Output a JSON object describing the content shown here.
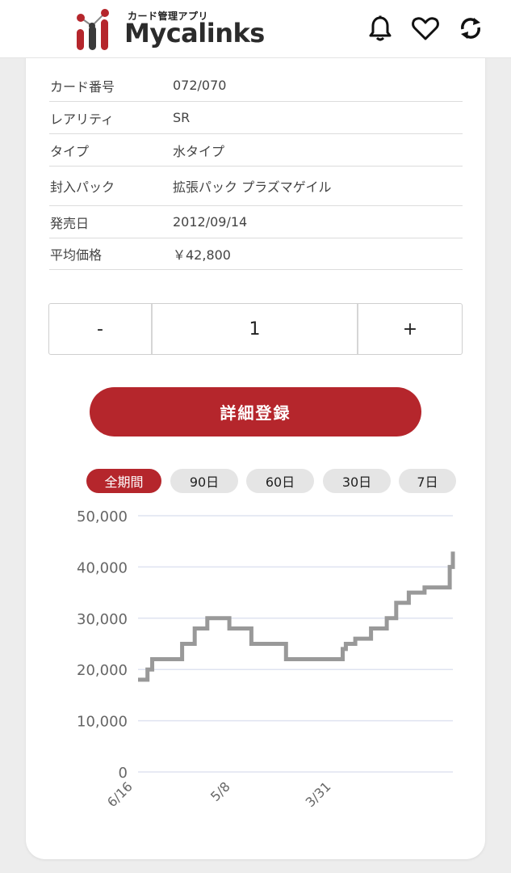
{
  "header": {
    "brand_sub": "カード管理アプリ",
    "brand_name": "Mycalinks",
    "icons": [
      "bell-icon",
      "heart-icon",
      "refresh-icon"
    ]
  },
  "details": [
    {
      "label": "カード番号",
      "value": "072/070"
    },
    {
      "label": "レアリティ",
      "value": "SR"
    },
    {
      "label": "タイプ",
      "value": "水タイプ"
    },
    {
      "label": "封入パック",
      "value": "拡張パック プラズマゲイル"
    },
    {
      "label": "発売日",
      "value": "2012/09/14"
    },
    {
      "label": "平均価格",
      "value": "￥42,800"
    }
  ],
  "quantity": {
    "minus": "-",
    "value": "1",
    "plus": "+"
  },
  "register_button": "詳細登録",
  "period_tabs": [
    {
      "label": "全期間",
      "active": true
    },
    {
      "label": "90日",
      "active": false
    },
    {
      "label": "60日",
      "active": false
    },
    {
      "label": "30日",
      "active": false
    },
    {
      "label": "7日",
      "active": false
    }
  ],
  "colors": {
    "accent": "#b5262c",
    "line": "#999999",
    "grid": "#dfe3f0"
  },
  "chart_data": {
    "type": "line",
    "title": "",
    "xlabel": "",
    "ylabel": "",
    "ylim": [
      0,
      50000
    ],
    "y_ticks": [
      "50,000",
      "40,000",
      "30,000",
      "20,000",
      "10,000",
      "0"
    ],
    "x_ticks": [
      "6/16",
      "5/8",
      "3/31"
    ],
    "grid": true,
    "series": [
      {
        "step": true,
        "x": [
          0,
          0.03,
          0.045,
          0.09,
          0.14,
          0.18,
          0.22,
          0.29,
          0.36,
          0.47,
          0.52,
          0.6,
          0.63,
          0.65,
          0.66,
          0.69,
          0.74,
          0.79,
          0.82,
          0.86,
          0.91,
          0.99,
          1.0
        ],
        "y": [
          18000,
          20000,
          22000,
          22000,
          25000,
          28000,
          30000,
          28000,
          25000,
          22000,
          22000,
          22000,
          22000,
          24000,
          25000,
          26000,
          28000,
          30000,
          33000,
          35000,
          36000,
          40000,
          43000
        ]
      }
    ]
  }
}
